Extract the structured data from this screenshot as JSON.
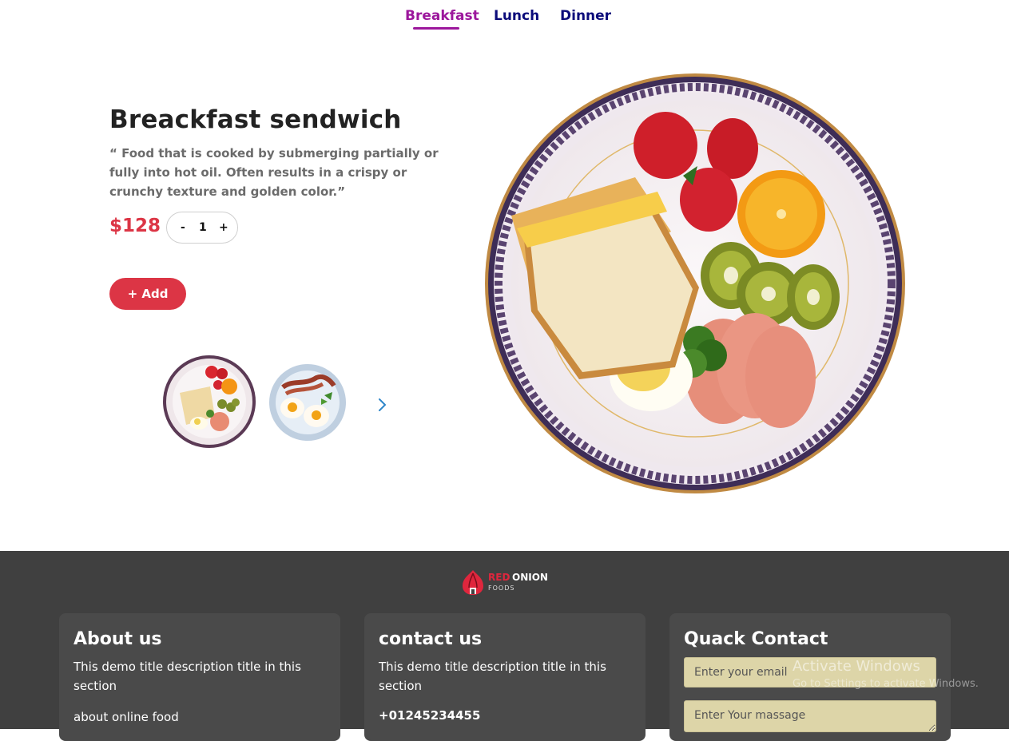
{
  "nav": {
    "tabs": [
      {
        "label": "Breakfast",
        "active": true
      },
      {
        "label": "Lunch",
        "active": false
      },
      {
        "label": "Dinner",
        "active": false
      }
    ]
  },
  "product": {
    "title": "Breackfast sendwich",
    "description": "“ Food that is cooked by submerging partially or fully into hot oil. Often results in a crispy or crunchy texture and golden color.”",
    "price": "$128",
    "quantity": "1",
    "minus_label": "-",
    "plus_label": "+",
    "add_label": "+ Add"
  },
  "footer": {
    "logo_red": "RED",
    "logo_white": "ONION",
    "logo_sub": "FOODS",
    "about": {
      "title": "About us",
      "desc": "This demo title description title in this section",
      "extra": "about online food"
    },
    "contact": {
      "title": "contact us",
      "desc": "This demo title description title in this section",
      "phone": "+01245234455"
    },
    "quick": {
      "title": "Quack Contact",
      "email_placeholder": "Enter your email",
      "message_placeholder": "Enter Your massage"
    }
  },
  "watermark": {
    "title": "Activate Windows",
    "subtitle": "Go to Settings to activate Windows."
  },
  "colors": {
    "accent_red": "#dc3545",
    "nav_active": "#9c179c",
    "nav_default": "#0b0b7a",
    "footer_bg": "#404040"
  }
}
